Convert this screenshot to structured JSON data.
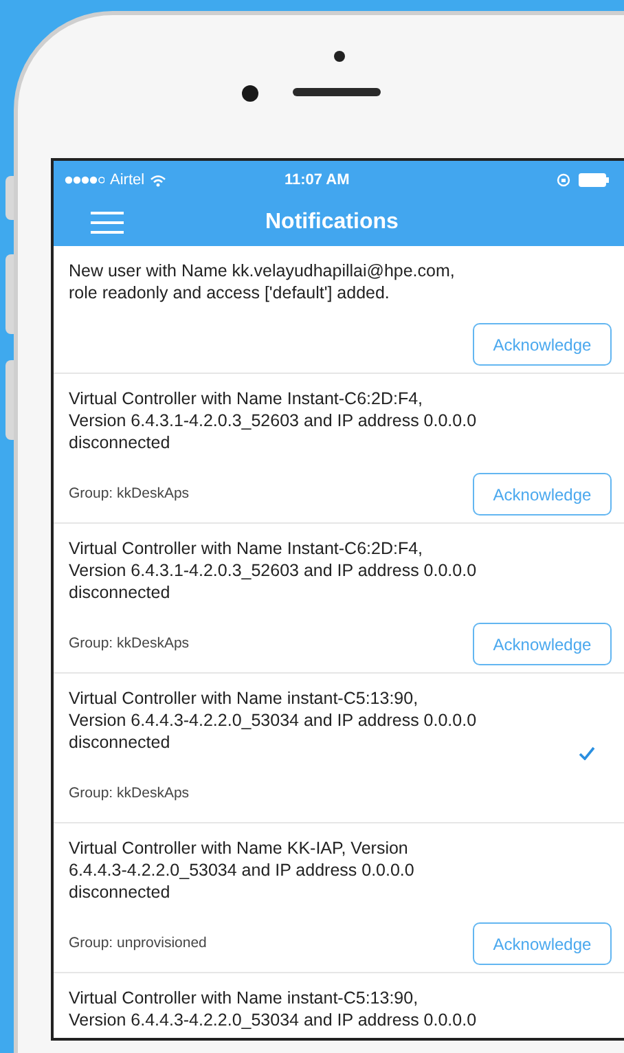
{
  "status_bar": {
    "carrier": "Airtel",
    "time": "11:07 AM"
  },
  "nav": {
    "title": "Notifications"
  },
  "notifications": [
    {
      "lines": [
        "New user with Name kk.velayudhapillai@hpe.com,",
        "role readonly and access ['default'] added."
      ],
      "acknowledged": false,
      "action": "Acknowledge"
    },
    {
      "lines": [
        "Virtual Controller with Name Instant-C6:2D:F4,",
        "Version 6.4.3.1-4.2.0.3_52603 and IP address 0.0.0.0",
        "disconnected"
      ],
      "group": "Group: kkDeskAps",
      "acknowledged": false,
      "action": "Acknowledge"
    },
    {
      "lines": [
        "Virtual Controller with Name Instant-C6:2D:F4,",
        "Version 6.4.3.1-4.2.0.3_52603 and IP address 0.0.0.0",
        "disconnected"
      ],
      "group": "Group: kkDeskAps",
      "acknowledged": false,
      "action": "Acknowledge"
    },
    {
      "lines": [
        "Virtual Controller with Name instant-C5:13:90,",
        "Version 6.4.4.3-4.2.2.0_53034 and IP address 0.0.0.0",
        "disconnected"
      ],
      "group": "Group: kkDeskAps",
      "acknowledged": true
    },
    {
      "lines": [
        "Virtual Controller with Name KK-IAP, Version",
        "6.4.4.3-4.2.2.0_53034 and IP address 0.0.0.0",
        "disconnected"
      ],
      "group": "Group: unprovisioned",
      "acknowledged": false,
      "action": "Acknowledge"
    },
    {
      "lines": [
        "Virtual Controller with Name instant-C5:13:90,",
        "Version 6.4.4.3-4.2.2.0_53034 and IP address 0.0.0.0"
      ]
    }
  ]
}
